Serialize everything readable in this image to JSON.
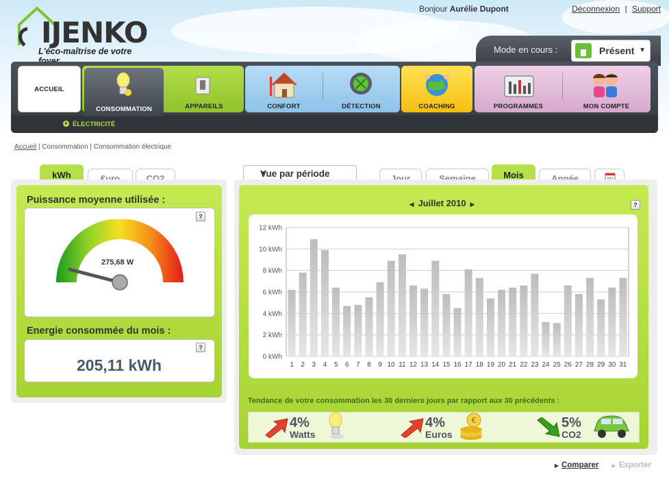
{
  "brand": {
    "name": "IJENKO",
    "tagline": "L'éco-maîtrise de votre foyer"
  },
  "header": {
    "greeting_prefix": "Bonjour",
    "user_name": "Aurélie Dupont",
    "logout": "Déconnexion",
    "support": "Support",
    "separator": "|",
    "mode_label": "Mode en cours :",
    "mode_value": "Présent"
  },
  "nav": {
    "home": "ACCUEIL",
    "consommation": "CONSOMMATION",
    "appareils": "APPAREILS",
    "confort": "CONFORT",
    "detection": "DÉTECTION",
    "coaching": "COACHING",
    "programmes": "PROGRAMMES",
    "mon_compte": "MON COMPTE",
    "sub_item": "ÉLECTRICITÉ"
  },
  "breadcrumb": {
    "home": "Accueil",
    "sep1": " | Consommation | ",
    "current": "Consommation électrique"
  },
  "left_tabs": [
    "kWh",
    "€uro",
    "CO2"
  ],
  "left_panel": {
    "power_title": "Puissance moyenne utilisée :",
    "power_value": "275,68 W",
    "power_fraction": 0.08,
    "energy_title": "Energie consommée du mois :",
    "energy_value": "205,11 kWh",
    "help": "?"
  },
  "right": {
    "view_select": "Vue par période",
    "tabs": [
      "Jour",
      "Semaine",
      "Mois",
      "Année"
    ],
    "active_tab": "Mois",
    "month": "Juillet 2010",
    "help": "?",
    "trend_text": "Tendance de votre consommation les 30 derniers jours par rapport aux 30 précédents :",
    "trends": [
      {
        "pct": "4%",
        "label": "Watts",
        "direction": "up",
        "color": "#e8402a"
      },
      {
        "pct": "4%",
        "label": "Euros",
        "direction": "up",
        "color": "#e8402a"
      },
      {
        "pct": "5%",
        "label": "CO2",
        "direction": "down",
        "color": "#3aa01a"
      }
    ]
  },
  "footer": {
    "compare": "Comparer",
    "export": "Exporter"
  },
  "colors": {
    "accent_green": "#a7d332",
    "nav_dark": "#3e444b",
    "bar": "#c9c9c9"
  },
  "chart_data": {
    "type": "bar",
    "categories": [
      "1",
      "2",
      "3",
      "4",
      "5",
      "6",
      "7",
      "8",
      "9",
      "10",
      "11",
      "12",
      "13",
      "14",
      "15",
      "16",
      "17",
      "18",
      "19",
      "20",
      "21",
      "22",
      "23",
      "24",
      "25",
      "26",
      "27",
      "28",
      "29",
      "30",
      "31"
    ],
    "series": [
      {
        "values": [
          6.2,
          7.8,
          10.9,
          9.9,
          6.4,
          4.7,
          4.8,
          5.5,
          6.9,
          8.9,
          9.5,
          6.6,
          6.3,
          8.9,
          5.8,
          4.5,
          8.1,
          7.3,
          5.4,
          6.2,
          6.4,
          6.6,
          7.7,
          3.2,
          3.1,
          6.6,
          5.8,
          7.3,
          5.3,
          6.4,
          7.3
        ]
      }
    ],
    "yticks": [
      "0 kWh",
      "2 kWh",
      "4 kWh",
      "6 kWh",
      "8 kWh",
      "10 kWh",
      "12 kWh"
    ],
    "ylim": [
      0,
      12
    ],
    "grid": true
  }
}
